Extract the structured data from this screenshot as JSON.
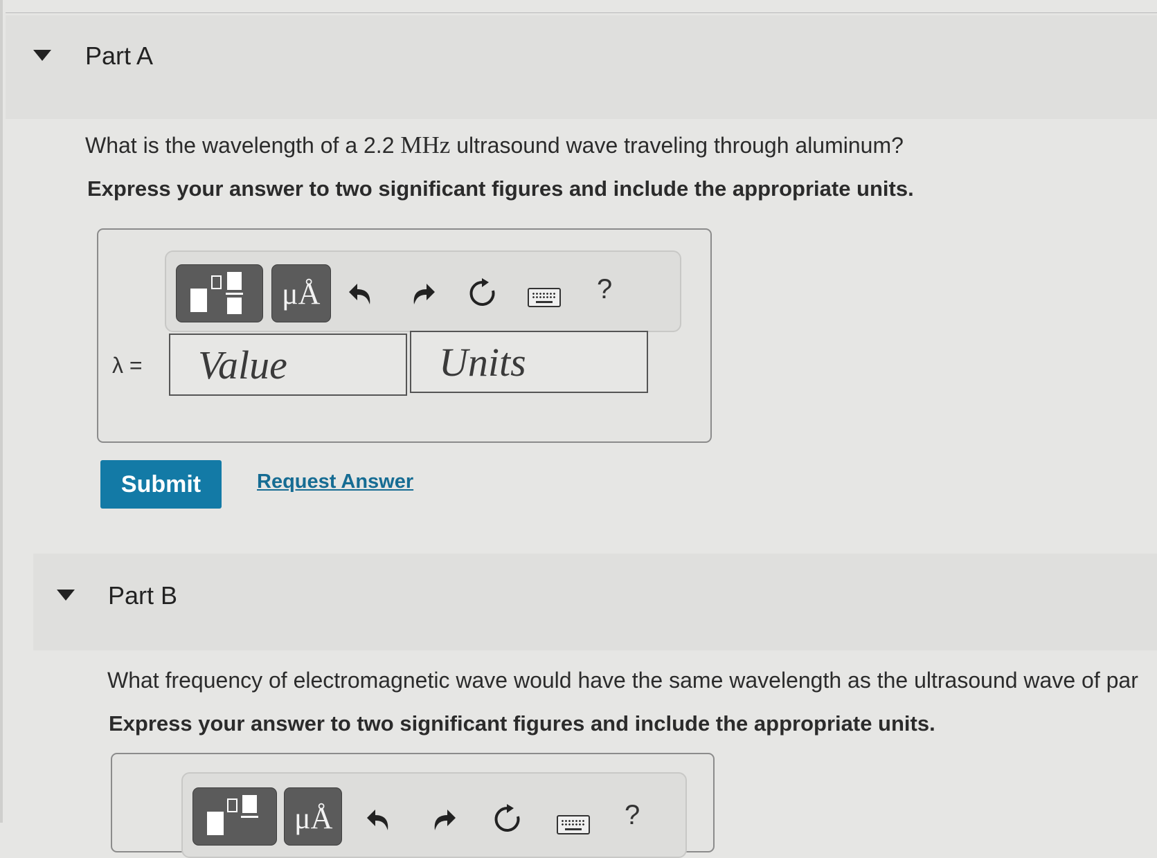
{
  "parts": [
    {
      "title": "Part A",
      "question_prefix": "What is the wavelength of a 2.2 ",
      "question_unit": "MHz",
      "question_suffix": " ultrasound wave traveling through aluminum?",
      "instruction": "Express your answer to two significant figures and include the appropriate units.",
      "toolbar": {
        "templates_icon": "fraction-templates-icon",
        "units_label": "μÅ",
        "undo_icon": "undo-icon",
        "redo_icon": "redo-icon",
        "reset_icon": "reset-icon",
        "keyboard_icon": "keyboard-icon",
        "help_label": "?"
      },
      "variable_label": "λ =",
      "value_placeholder": "Value",
      "units_placeholder": "Units",
      "submit_label": "Submit",
      "request_answer_label": "Request Answer"
    },
    {
      "title": "Part B",
      "question": "What frequency of electromagnetic wave would have the same wavelength as the ultrasound wave of par",
      "instruction": "Express your answer to two significant figures and include the appropriate units.",
      "toolbar": {
        "units_label": "μÅ",
        "help_label": "?"
      }
    }
  ],
  "colors": {
    "submit": "#137aa6",
    "link": "#166c93",
    "toolbar_button": "#5b5b5b"
  }
}
